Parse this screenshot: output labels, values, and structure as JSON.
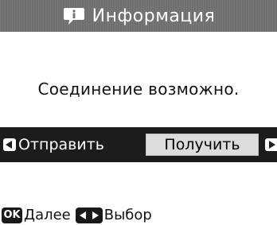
{
  "header": {
    "title": "Информация",
    "icon": "info-speech-bubble-icon"
  },
  "message": "Соединение возможно.",
  "selector": {
    "options": [
      "Отправить",
      "Получить"
    ],
    "selected": "Получить",
    "left_icon": "arrow-left-icon",
    "right_icon": "arrow-right-icon"
  },
  "footer": {
    "ok_badge": "OK",
    "ok_label": "Далее",
    "nav_icon": "left-right-arrows-icon",
    "nav_label": "Выбор"
  },
  "colors": {
    "header_bg": "#6f6f6f",
    "selbar_bg": "#1c1c1c",
    "highlight_bg": "#dcdcdc"
  }
}
